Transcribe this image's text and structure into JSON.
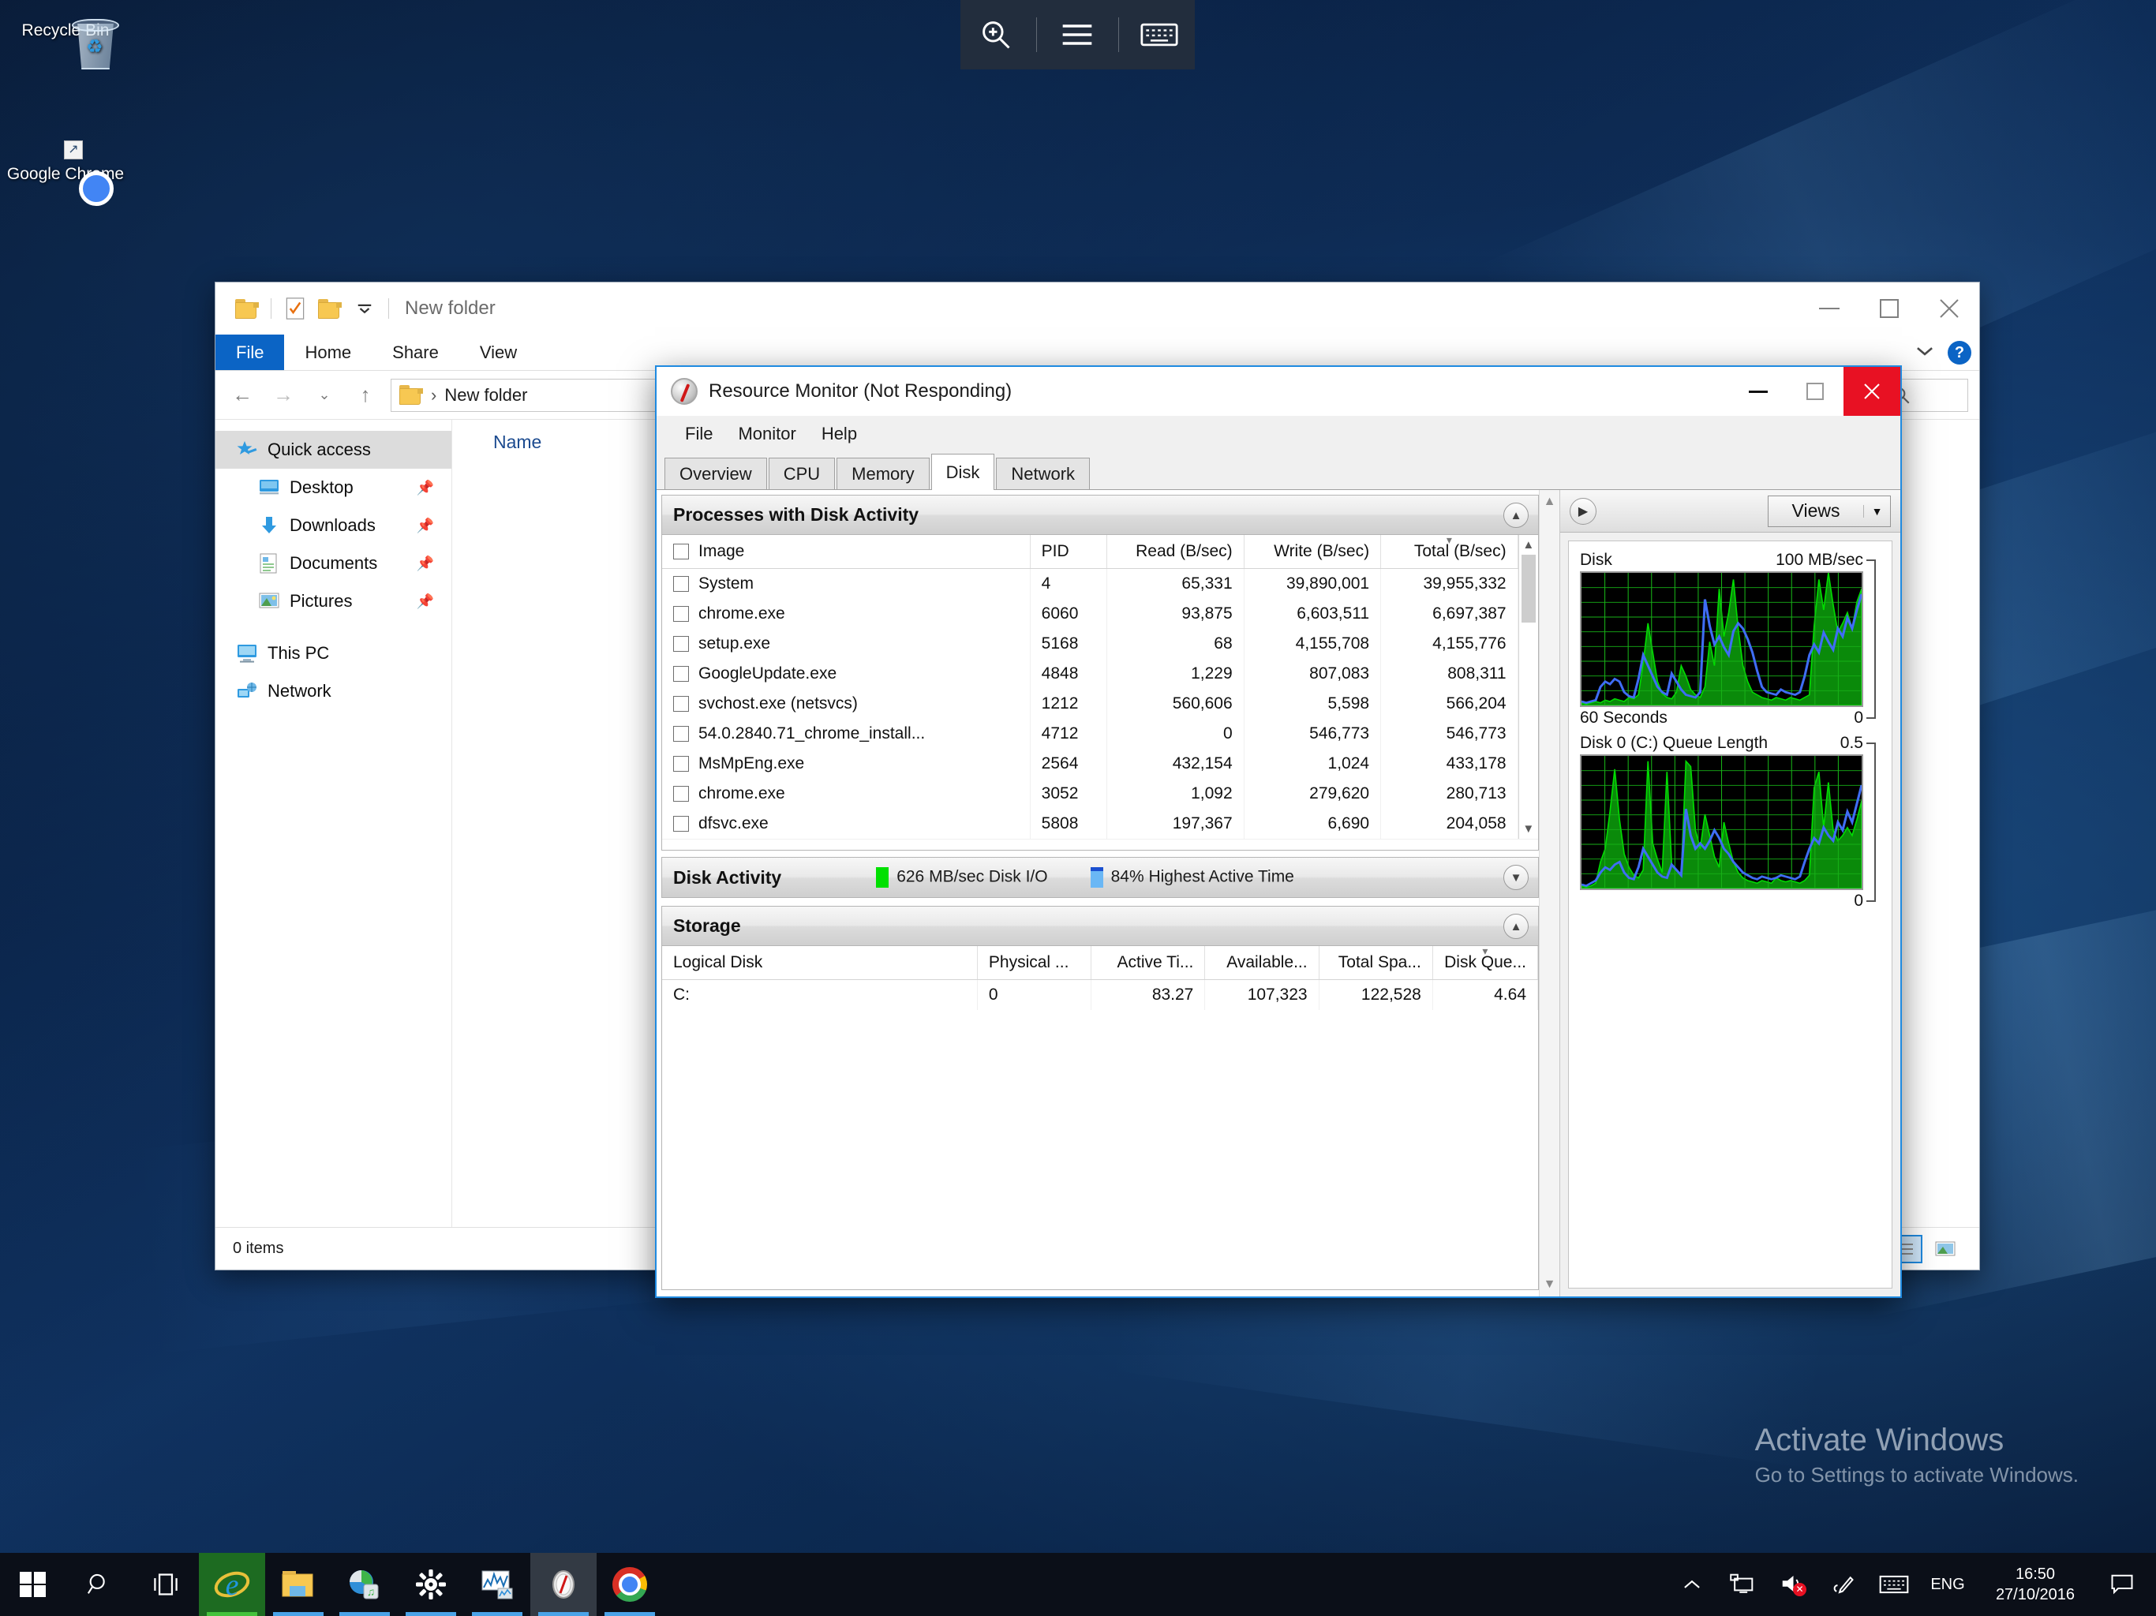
{
  "desktop": {
    "icons": [
      {
        "label": "Recycle Bin",
        "icon": "recycle-bin-icon"
      },
      {
        "label": "Google Chrome",
        "icon": "google-chrome-icon"
      }
    ],
    "watermark": {
      "line1": "Activate Windows",
      "line2": "Go to Settings to activate Windows."
    }
  },
  "top_toolbar": {
    "buttons": [
      {
        "name": "magnifier-zoom-icon",
        "glyph": "zoom-in"
      },
      {
        "name": "hamburger-menu-icon",
        "glyph": "menu"
      },
      {
        "name": "on-screen-keyboard-icon",
        "glyph": "keyboard"
      }
    ]
  },
  "explorer": {
    "title": "New folder",
    "quick_access_toolbar": [
      {
        "name": "folder-icon",
        "label": ""
      },
      {
        "name": "properties-icon",
        "label": ""
      },
      {
        "name": "new-folder-icon",
        "label": ""
      },
      {
        "name": "customize-qat-chevron-icon",
        "label": ""
      }
    ],
    "window_controls": {
      "minimize": "—",
      "maximize": "☐",
      "close": "✕"
    },
    "ribbon_tabs": [
      {
        "label": "File",
        "active": true
      },
      {
        "label": "Home",
        "active": false
      },
      {
        "label": "Share",
        "active": false
      },
      {
        "label": "View",
        "active": false
      }
    ],
    "ribbon_right": {
      "collapse": "chevron-down-icon",
      "help": "?"
    },
    "address": {
      "path": "New folder",
      "separator": "›"
    },
    "search_placeholder": "",
    "nav_pane": [
      {
        "label": "Quick access",
        "icon": "star-pin-icon",
        "level": 0,
        "selected": true,
        "pinned": false
      },
      {
        "label": "Desktop",
        "icon": "desktop-icon",
        "level": 1,
        "selected": false,
        "pinned": true
      },
      {
        "label": "Downloads",
        "icon": "downloads-icon",
        "level": 1,
        "selected": false,
        "pinned": true
      },
      {
        "label": "Documents",
        "icon": "documents-icon",
        "level": 1,
        "selected": false,
        "pinned": true
      },
      {
        "label": "Pictures",
        "icon": "pictures-icon",
        "level": 1,
        "selected": false,
        "pinned": true
      },
      {
        "label": "This PC",
        "icon": "this-pc-icon",
        "level": 0,
        "selected": false,
        "pinned": false
      },
      {
        "label": "Network",
        "icon": "network-icon",
        "level": 0,
        "selected": false,
        "pinned": false
      }
    ],
    "column_header": "Name",
    "status": "0 items",
    "view_toggles": [
      {
        "name": "details-view-icon",
        "active": true
      },
      {
        "name": "large-icons-view-icon",
        "active": false
      }
    ]
  },
  "resmon": {
    "title": "Resource Monitor (Not Responding)",
    "window_controls": {
      "minimize": "—",
      "maximize": "☐",
      "close": "✕"
    },
    "menus": [
      "File",
      "Monitor",
      "Help"
    ],
    "tabs": [
      {
        "label": "Overview",
        "active": false
      },
      {
        "label": "CPU",
        "active": false
      },
      {
        "label": "Memory",
        "active": false
      },
      {
        "label": "Disk",
        "active": true
      },
      {
        "label": "Network",
        "active": false
      }
    ],
    "processes_section": {
      "title": "Processes with Disk Activity",
      "collapse_icon": "chevron-up-icon",
      "columns": [
        "Image",
        "PID",
        "Read (B/sec)",
        "Write (B/sec)",
        "Total (B/sec)"
      ],
      "sort_column": "Total (B/sec)",
      "sort_direction": "descending",
      "rows": [
        {
          "image": "System",
          "pid": "4",
          "read": "65,331",
          "write": "39,890,001",
          "total": "39,955,332"
        },
        {
          "image": "chrome.exe",
          "pid": "6060",
          "read": "93,875",
          "write": "6,603,511",
          "total": "6,697,387"
        },
        {
          "image": "setup.exe",
          "pid": "5168",
          "read": "68",
          "write": "4,155,708",
          "total": "4,155,776"
        },
        {
          "image": "GoogleUpdate.exe",
          "pid": "4848",
          "read": "1,229",
          "write": "807,083",
          "total": "808,311"
        },
        {
          "image": "svchost.exe (netsvcs)",
          "pid": "1212",
          "read": "560,606",
          "write": "5,598",
          "total": "566,204"
        },
        {
          "image": "54.0.2840.71_chrome_install...",
          "pid": "4712",
          "read": "0",
          "write": "546,773",
          "total": "546,773"
        },
        {
          "image": "MsMpEng.exe",
          "pid": "2564",
          "read": "432,154",
          "write": "1,024",
          "total": "433,178"
        },
        {
          "image": "chrome.exe",
          "pid": "3052",
          "read": "1,092",
          "write": "279,620",
          "total": "280,713"
        },
        {
          "image": "dfsvc.exe",
          "pid": "5808",
          "read": "197,367",
          "write": "6,690",
          "total": "204,058"
        }
      ]
    },
    "disk_activity_section": {
      "title": "Disk Activity",
      "expand_icon": "chevron-down-icon",
      "metrics": [
        {
          "label": "626 MB/sec Disk I/O",
          "color": "#00e000"
        },
        {
          "label": "84% Highest Active Time",
          "color": "#6ab7f5"
        }
      ]
    },
    "storage_section": {
      "title": "Storage",
      "collapse_icon": "chevron-up-icon",
      "columns": [
        "Logical Disk",
        "Physical ...",
        "Active Ti...",
        "Available...",
        "Total Spa...",
        "Disk Que..."
      ],
      "rows": [
        {
          "logical_disk": "C:",
          "physical": "0",
          "active_time": "83.27",
          "available": "107,323",
          "total_space": "122,528",
          "disk_queue": "4.64"
        }
      ]
    },
    "graphs_panel": {
      "expand_icon": "chevron-right-icon",
      "views_button": {
        "label": "Views",
        "arrow": "chevron-down-icon"
      }
    }
  },
  "chart_data": [
    {
      "type": "area",
      "title": "Disk",
      "ylabel": "",
      "xlabel": "60 Seconds",
      "ytop_label": "100 MB/sec",
      "ybottom_label": "0",
      "ylim": [
        0,
        100
      ],
      "grid": true,
      "legend_position": "none",
      "series": [
        {
          "name": "Disk I/O (MB/sec)",
          "color": "#00dd00",
          "style": "filled-area",
          "values": [
            2,
            1,
            2,
            3,
            2,
            4,
            3,
            5,
            4,
            3,
            6,
            5,
            8,
            32,
            62,
            40,
            18,
            9,
            6,
            5,
            10,
            30,
            22,
            12,
            8,
            6,
            14,
            48,
            30,
            88,
            52,
            70,
            95,
            58,
            30,
            18,
            10,
            8,
            6,
            5,
            4,
            6,
            5,
            4,
            6,
            5,
            4,
            6,
            8,
            60,
            95,
            72,
            100,
            76,
            55,
            62,
            70,
            58,
            78,
            88
          ]
        },
        {
          "name": "Highest Active Time (%)",
          "color": "#3f6df5",
          "style": "line",
          "values": [
            3,
            2,
            3,
            4,
            14,
            18,
            16,
            20,
            18,
            10,
            7,
            6,
            20,
            38,
            30,
            22,
            14,
            10,
            8,
            24,
            18,
            12,
            8,
            7,
            6,
            10,
            80,
            60,
            46,
            52,
            44,
            38,
            56,
            62,
            58,
            50,
            40,
            26,
            14,
            10,
            9,
            8,
            12,
            10,
            9,
            8,
            10,
            22,
            38,
            46,
            40,
            55,
            48,
            42,
            58,
            52,
            66,
            58,
            72,
            84
          ]
        }
      ]
    },
    {
      "type": "area",
      "title": "Disk 0 (C:) Queue Length",
      "ylabel": "",
      "xlabel": "",
      "ytop_label": "0.5",
      "ybottom_label": "0",
      "ylim": [
        0,
        0.5
      ],
      "grid": true,
      "legend_position": "none",
      "series": [
        {
          "name": "Queue Length",
          "color": "#00dd00",
          "style": "filled-area",
          "values": [
            2,
            1,
            2,
            4,
            20,
            30,
            58,
            90,
            52,
            26,
            16,
            10,
            8,
            14,
            96,
            34,
            22,
            12,
            88,
            18,
            14,
            10,
            96,
            92,
            44,
            30,
            56,
            40,
            24,
            16,
            50,
            34,
            20,
            12,
            8,
            6,
            5,
            4,
            6,
            5,
            4,
            8,
            6,
            5,
            6,
            5,
            4,
            6,
            10,
            76,
            88,
            46,
            80,
            44,
            36,
            40,
            46,
            40,
            52,
            66
          ]
        },
        {
          "name": "Queue Length (line)",
          "color": "#3f6df5",
          "style": "line",
          "values": [
            3,
            2,
            4,
            6,
            12,
            16,
            14,
            18,
            20,
            12,
            8,
            7,
            16,
            30,
            24,
            18,
            12,
            9,
            8,
            18,
            14,
            10,
            60,
            40,
            30,
            34,
            30,
            36,
            44,
            38,
            30,
            26,
            20,
            16,
            12,
            10,
            8,
            7,
            9,
            8,
            7,
            8,
            10,
            9,
            8,
            7,
            9,
            20,
            30,
            38,
            34,
            46,
            40,
            36,
            50,
            44,
            58,
            50,
            64,
            78
          ]
        }
      ]
    }
  ],
  "taskbar": {
    "start": {
      "name": "windows-start-icon"
    },
    "search": {
      "name": "search-icon"
    },
    "taskview": {
      "name": "task-view-icon"
    },
    "apps": [
      {
        "name": "internet-explorer-icon",
        "running": true
      },
      {
        "name": "file-explorer-icon",
        "running": true
      },
      {
        "name": "store-icon",
        "running": true
      },
      {
        "name": "settings-gear-icon",
        "running": true
      },
      {
        "name": "performance-monitor-icon",
        "running": true
      },
      {
        "name": "resource-monitor-icon",
        "running": true,
        "active": true
      },
      {
        "name": "google-chrome-icon",
        "running": true
      }
    ],
    "tray": {
      "show_hidden": "chevron-up-icon",
      "icons": [
        "network-icon",
        "volume-muted-icon",
        "pen-workspace-icon",
        "touch-keyboard-icon"
      ],
      "language": "ENG",
      "time": "16:50",
      "date": "27/10/2016",
      "action_center": "action-center-icon"
    }
  }
}
